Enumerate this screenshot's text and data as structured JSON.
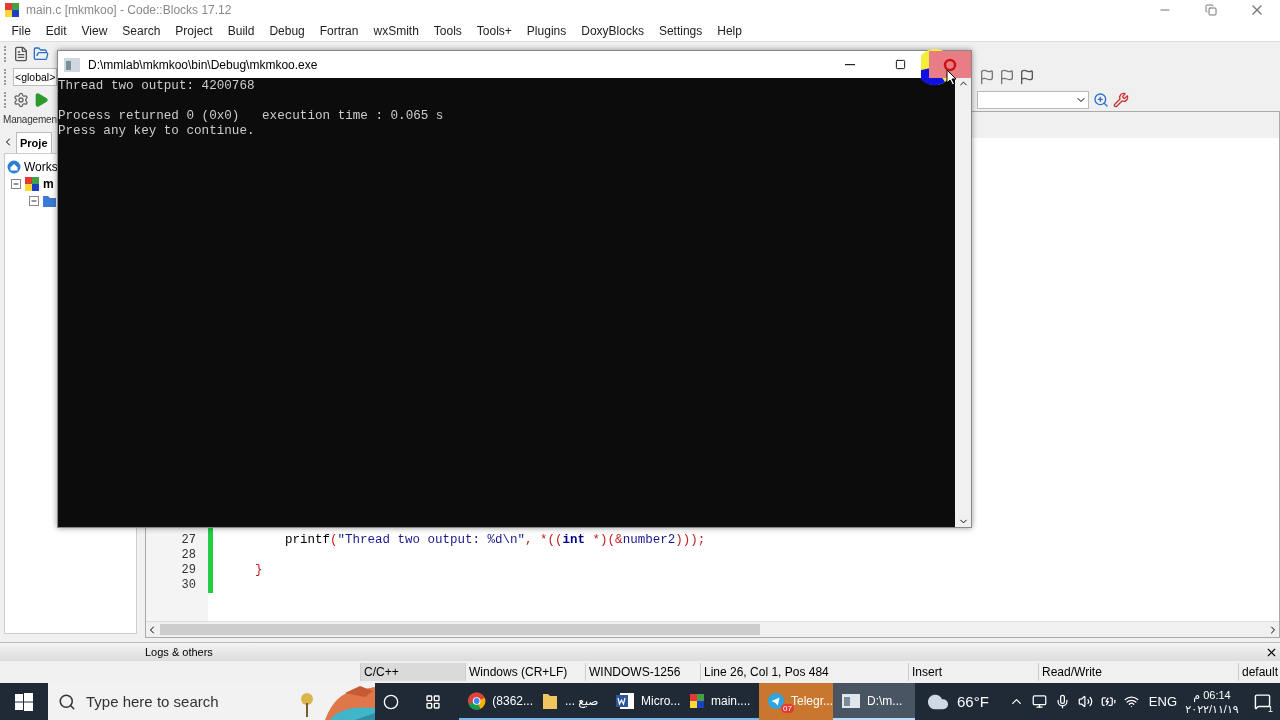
{
  "window": {
    "title": "main.c [mkmkoo] - Code::Blocks 17.12"
  },
  "menu": [
    "File",
    "Edit",
    "View",
    "Search",
    "Project",
    "Build",
    "Debug",
    "Fortran",
    "wxSmith",
    "Tools",
    "Tools+",
    "Plugins",
    "DoxyBlocks",
    "Settings",
    "Help"
  ],
  "scope_dropdown": {
    "value": "<global>"
  },
  "management_panel": {
    "title": "Managemen",
    "tabs": [
      {
        "label": "Proje",
        "selected": true
      }
    ],
    "tree": [
      {
        "label": "Works",
        "children": [
          {
            "label": "m",
            "expanded": true,
            "children": [
              {
                "expanded": true
              }
            ]
          }
        ]
      }
    ]
  },
  "editor": {
    "lines": [
      {
        "number": "27",
        "tokens": [
          {
            "kind": "plain",
            "text": "        printf"
          },
          {
            "kind": "operator",
            "text": "("
          },
          {
            "kind": "string",
            "text": "\"Thread two output: %d\\n\""
          },
          {
            "kind": "operator",
            "text": ", *(("
          },
          {
            "kind": "keyword",
            "text": "int"
          },
          {
            "kind": "operator",
            "text": " *)(&"
          },
          {
            "kind": "identifier",
            "text": "number2"
          },
          {
            "kind": "operator",
            "text": ")));"
          }
        ]
      },
      {
        "number": "28"
      },
      {
        "number": "29",
        "tokens": [
          {
            "kind": "operator",
            "text": "    }"
          }
        ]
      },
      {
        "number": "30"
      }
    ]
  },
  "logs_panel": {
    "title": "Logs & others"
  },
  "status_bar": [
    {
      "text": "C/C++",
      "highlighted": true
    },
    {
      "text": "Windows (CR+LF)",
      "highlighted": false
    },
    {
      "text": "WINDOWS-1256",
      "highlighted": false
    },
    {
      "text": "Line 26, Col 1, Pos 484",
      "highlighted": false
    },
    {
      "text": "Insert",
      "highlighted": false
    },
    {
      "text": "Read/Write",
      "highlighted": false
    },
    {
      "text": "default",
      "highlighted": false
    }
  ],
  "console": {
    "title": "D:\\mmlab\\mkmkoo\\bin\\Debug\\mkmkoo.exe",
    "close_hovered": true,
    "paragraphs": [
      [
        "Thread two output: 4200768"
      ],
      [
        "Process returned 0 (0x0)   execution time : 0.065 s",
        "Press any key to continue."
      ]
    ]
  },
  "taskbar": {
    "search": {
      "placeholder": "Type here to search"
    },
    "apps": [
      {
        "kind": "chrome",
        "label": "(8362...",
        "running": true,
        "selected": false,
        "flashing": false
      },
      {
        "kind": "folder",
        "label": "صبع ...",
        "running": true,
        "selected": false,
        "flashing": false
      },
      {
        "kind": "word",
        "label": "Micro...",
        "running": true,
        "selected": false,
        "flashing": false
      },
      {
        "kind": "codeblocks",
        "label": "main....",
        "running": true,
        "selected": false,
        "flashing": false
      },
      {
        "kind": "telegram",
        "label": "Telegr...",
        "badge": "07",
        "running": false,
        "selected": false,
        "flashing": true
      },
      {
        "kind": "console",
        "label": "D:\\m...",
        "running": true,
        "selected": true,
        "flashing": false
      }
    ],
    "weather": "66°F",
    "language": "ENG",
    "time": "06:14 م",
    "date": "٢٠٢٢/١١/١٩",
    "notifications": "1"
  }
}
